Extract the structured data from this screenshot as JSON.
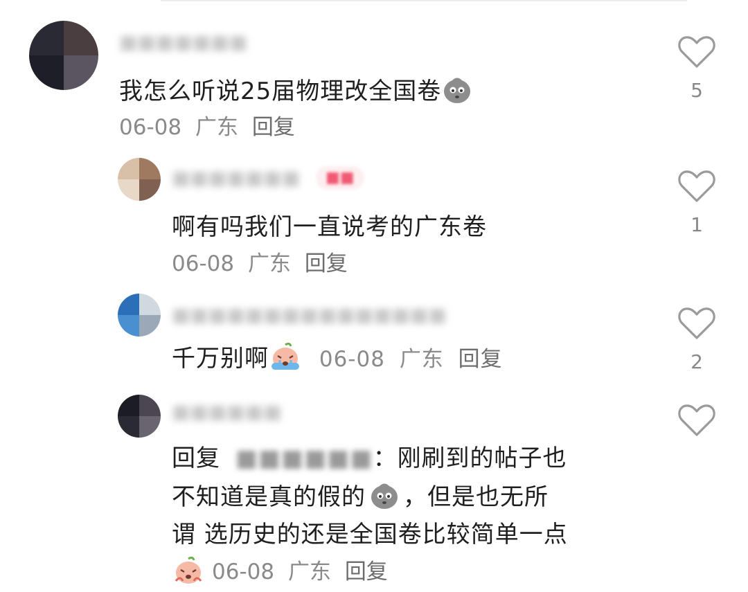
{
  "comments": [
    {
      "text": "我怎么听说25届物理改全国卷",
      "date": "06-08",
      "location": "广东",
      "reply_label": "回复",
      "likes": "5",
      "emoji": "grey-sad-face-icon",
      "avatar_colors": [
        "#2a2a35",
        "#4a3e40",
        "#1e1e28",
        "#5a5560"
      ]
    },
    {
      "text": "啊有吗我们一直说考的广东卷",
      "date": "06-08",
      "location": "广东",
      "reply_label": "回复",
      "likes": "1",
      "avatar_colors": [
        "#d8c0a8",
        "#a07a60",
        "#e8d8c8",
        "#806050"
      ]
    },
    {
      "text": "千万别啊",
      "date": "06-08",
      "location": "广东",
      "reply_label": "回复",
      "likes": "2",
      "emoji": "crying-peach-icon",
      "avatar_colors": [
        "#2b6fb8",
        "#d0d8e0",
        "#4a90d0",
        "#9aa8b8"
      ]
    },
    {
      "reply_prefix": "回复",
      "quoted_suffix": "：",
      "text_line1": "刚刷到的帖子也",
      "text_line2_a": "不知道是真的假的",
      "text_line2_b": "，但是也无所",
      "text_line3": "谓 选历史的还是全国卷比较简单一点",
      "date": "06-08",
      "location": "广东",
      "reply_label": "回复",
      "avatar_colors": [
        "#1c1c24",
        "#4c4650",
        "#2a2a32",
        "#6a6470"
      ]
    }
  ],
  "colors": {
    "text": "#1f1f1f",
    "meta": "#8a8a8a",
    "heart_outline": "#9a9a9a",
    "author_tag_bg": "#fdeef0",
    "author_tag_fg": "#f05a72"
  }
}
